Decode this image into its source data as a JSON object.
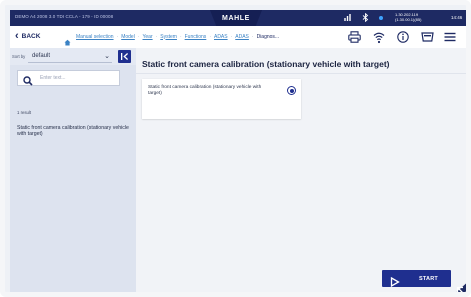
{
  "statusbar": {
    "vehicle": "DEMO A4 2008 3.0 TDI CCLA - 179 - ID 00008",
    "brand": "MAHLE",
    "version_line1": "1.30.202.119",
    "version_line2": "(1.30.00.1)(85)",
    "time": "14:46"
  },
  "toolbar": {
    "back_label": "BACK",
    "breadcrumbs": [
      "Manual selection",
      "Model",
      "Year",
      "System",
      "Functions",
      "ADAS",
      "ADAS",
      "Diagnos..."
    ]
  },
  "sidebar": {
    "sort_label": "Sort by",
    "sort_value": "default",
    "search_placeholder": "Enter text...",
    "result_count": "1 result",
    "results": [
      "Static front camera calibration (stationary vehicle with target)"
    ]
  },
  "main": {
    "title": "Static front camera calibration (stationary vehicle with target)",
    "option_label": "Static front camera calibration (stationary vehicle with target)",
    "option_selected": true,
    "start_label": "START"
  },
  "colors": {
    "brand_navy": "#1e2a63",
    "accent_blue": "#1f2f8f",
    "link_blue": "#3b82c4"
  },
  "icons": [
    "home-icon",
    "printer-icon",
    "wireless-icon",
    "info-icon",
    "vci-icon",
    "menu-icon",
    "search-icon",
    "collapse-sidebar-icon",
    "play-icon",
    "diagonal-arrow-icon"
  ]
}
